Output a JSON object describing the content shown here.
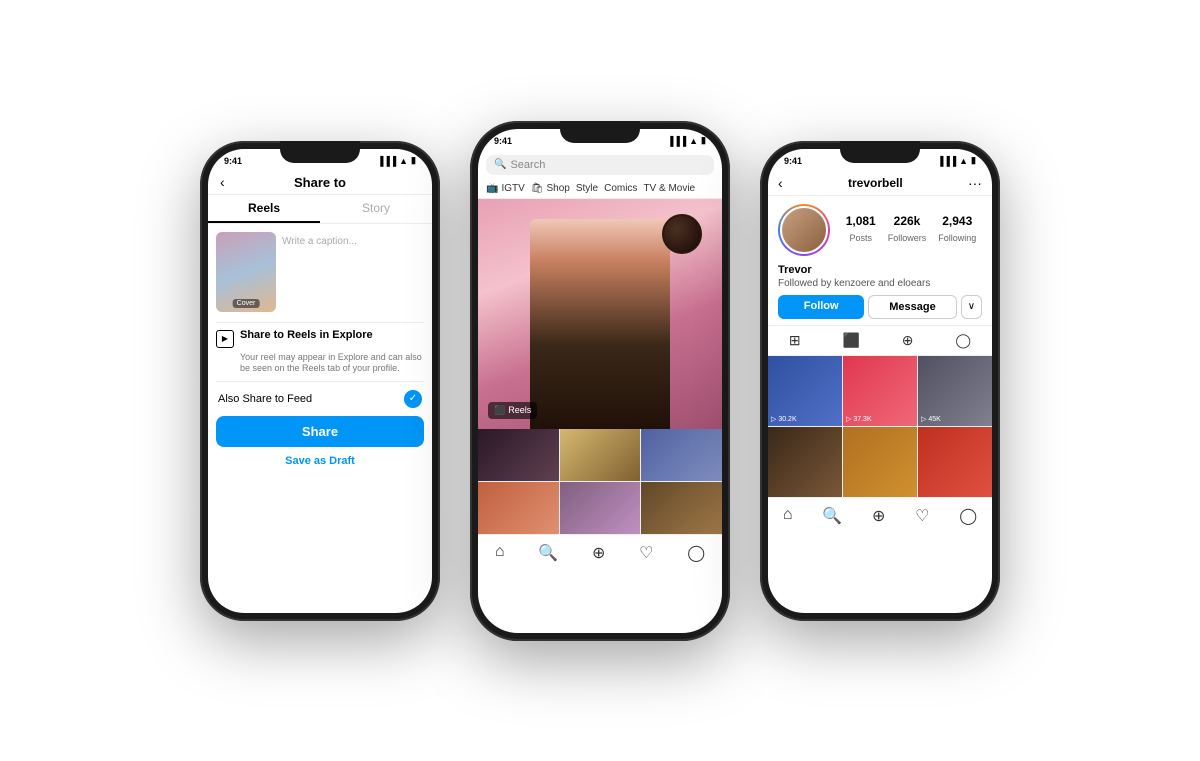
{
  "phone1": {
    "status_time": "9:41",
    "title": "Share to",
    "back_arrow": "‹",
    "tab_reels": "Reels",
    "tab_story": "Story",
    "caption_placeholder": "Write a caption...",
    "cover_label": "Cover",
    "share_reels_title": "Share to Reels in Explore",
    "share_reels_desc": "Your reel may appear in Explore and can also be seen on the Reels tab of your profile.",
    "also_share_label": "Also Share to Feed",
    "share_btn": "Share",
    "draft_btn": "Save as Draft"
  },
  "phone2": {
    "status_time": "9:41",
    "search_placeholder": "Search",
    "categories": [
      "IGTV",
      "Shop",
      "Style",
      "Comics",
      "TV & Movie"
    ],
    "reels_badge": "Reels"
  },
  "phone3": {
    "status_time": "9:41",
    "username": "trevorbell",
    "posts": "1,081",
    "posts_label": "Posts",
    "followers": "226k",
    "followers_label": "Followers",
    "following": "2,943",
    "following_label": "Following",
    "name": "Trevor",
    "followed_by": "Followed by kenzoere and eloears",
    "follow_btn": "Follow",
    "message_btn": "Message",
    "more_btn": "∨",
    "view_counts": [
      "▷ 30.2K",
      "▷ 37.3K",
      "▷ 45K"
    ]
  }
}
